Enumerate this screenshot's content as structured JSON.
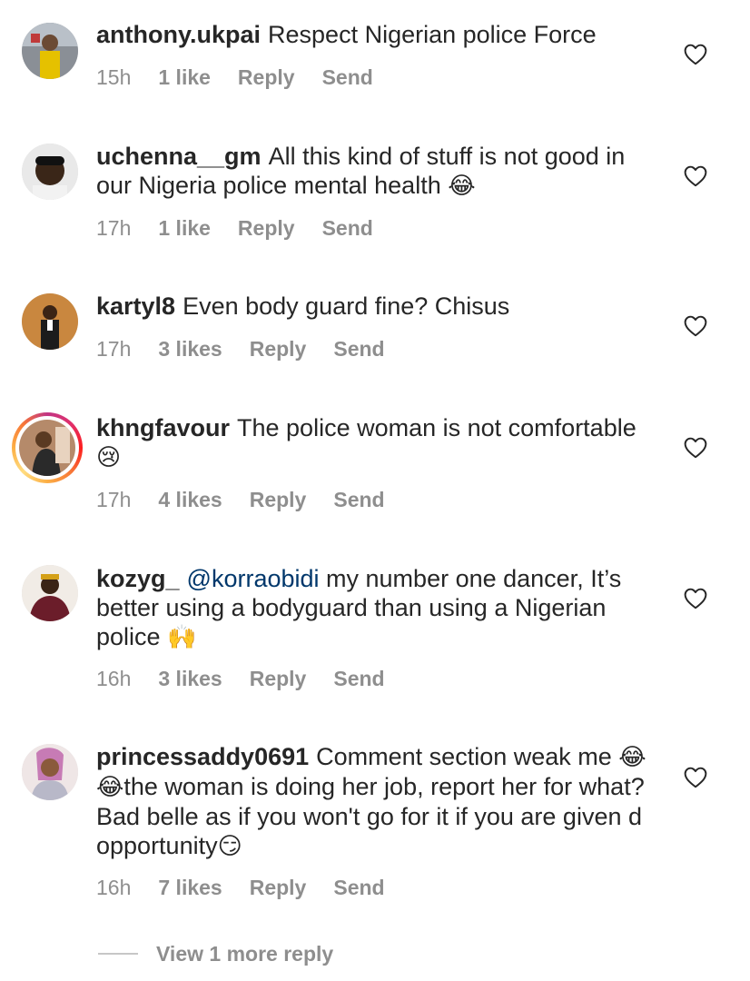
{
  "comments": [
    {
      "username": "anthony.ukpai",
      "text": "Respect Nigerian police Force",
      "time": "15h",
      "likes": "1 like",
      "reply": "Reply",
      "send": "Send"
    },
    {
      "username": "uchenna__gm",
      "text": "All this kind of stuff is not good in our Nigeria police mental health",
      "emoji": "😂",
      "time": "17h",
      "likes": "1 like",
      "reply": "Reply",
      "send": "Send"
    },
    {
      "username": "kartyl8",
      "text": "Even body guard fine? Chisus",
      "time": "17h",
      "likes": "3 likes",
      "reply": "Reply",
      "send": "Send"
    },
    {
      "username": "khngfavour",
      "text": "The police woman is not comfortable",
      "emoji": "😢",
      "time": "17h",
      "likes": "4 likes",
      "reply": "Reply",
      "send": "Send"
    },
    {
      "username": "kozyg_",
      "mention": "@korraobidi",
      "text": "my number one dancer, It’s better using a bodyguard than using a Nigerian police",
      "emoji": "🙌",
      "time": "16h",
      "likes": "3 likes",
      "reply": "Reply",
      "send": "Send"
    },
    {
      "username": "princessaddy0691",
      "text_before": "Comment section weak me",
      "emoji_before": "😂😂",
      "text": "the woman is doing her job, report her for what? Bad belle as if you won't go for it if you are given d opportunity",
      "emoji": "😏",
      "time": "16h",
      "likes": "7 likes",
      "reply": "Reply",
      "send": "Send"
    }
  ],
  "view_more": "View 1 more reply",
  "colors": {
    "text": "#262626",
    "secondary": "#8e8e8e",
    "mention": "#00376b",
    "story_ring": "#e1306c"
  },
  "icons": {
    "like": "heart-outline-icon"
  }
}
